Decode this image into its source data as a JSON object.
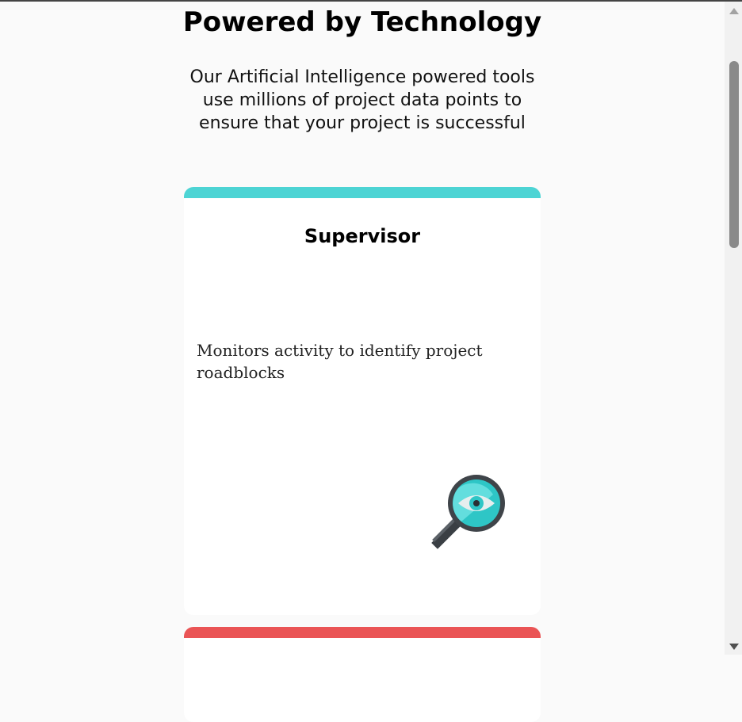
{
  "section": {
    "heading": "Powered by Technology",
    "intro": "Our Artificial Intelligence powered tools use millions of project data points to ensure that your project is successful"
  },
  "cards": [
    {
      "title": "Supervisor",
      "description": "Monitors activity to identify project roadblocks",
      "stripe_color": "#4dd4d4",
      "icon": "magnifier-eye-icon"
    },
    {
      "title": "",
      "description": "",
      "stripe_color": "#ea5455",
      "icon": ""
    }
  ],
  "scrollbar": {
    "up_icon": "scroll-up-arrow-icon",
    "down_icon": "scroll-down-arrow-icon"
  }
}
